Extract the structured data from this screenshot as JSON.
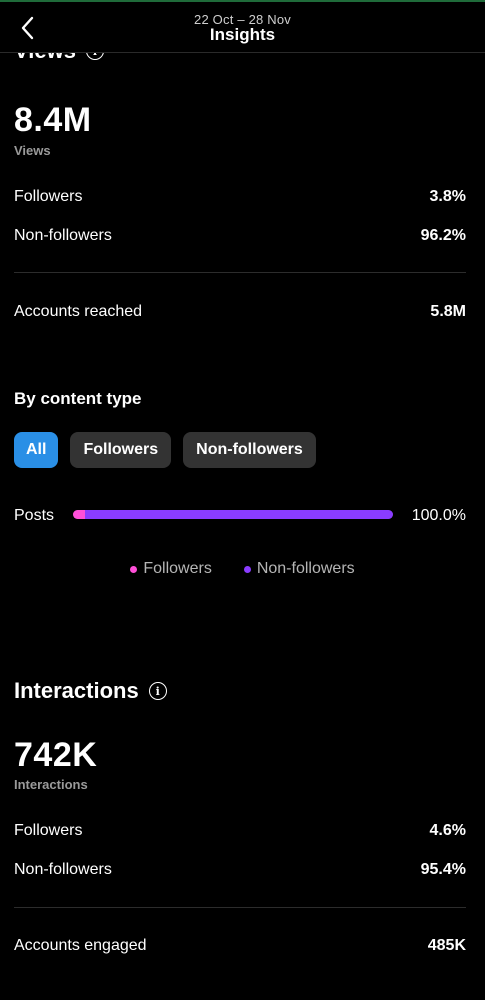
{
  "header": {
    "date_range": "22 Oct – 28 Nov",
    "title": "Insights"
  },
  "views": {
    "section_title": "Views",
    "total": "8.4M",
    "total_label": "Views",
    "followers_label": "Followers",
    "followers_value": "3.8%",
    "non_followers_label": "Non-followers",
    "non_followers_value": "96.2%",
    "accounts_reached_label": "Accounts reached",
    "accounts_reached_value": "5.8M"
  },
  "content_type": {
    "title": "By content type",
    "filters": [
      "All",
      "Followers",
      "Non-followers"
    ],
    "selected_filter": "All",
    "posts_label": "Posts",
    "posts_value": "100.0%",
    "posts_followers_fraction": 0.038,
    "posts_non_followers_fraction": 0.962,
    "legend": [
      "Followers",
      "Non-followers"
    ],
    "colors": {
      "followers": "#ff4fd8",
      "non_followers": "#8a3cff",
      "active_chip": "#2a8fe6"
    }
  },
  "interactions": {
    "section_title": "Interactions",
    "total": "742K",
    "total_label": "Interactions",
    "followers_label": "Followers",
    "followers_value": "4.6%",
    "non_followers_label": "Non-followers",
    "non_followers_value": "95.4%",
    "accounts_engaged_label": "Accounts engaged",
    "accounts_engaged_value": "485K"
  },
  "icons": [
    "back-chevron-icon",
    "info-icon"
  ]
}
